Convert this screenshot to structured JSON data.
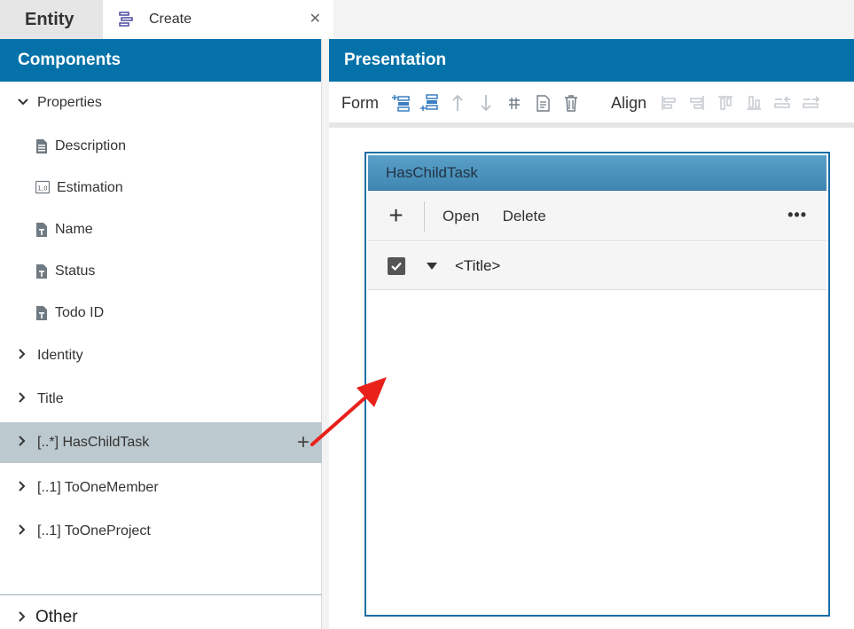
{
  "tabs": {
    "entity_label": "Entity",
    "create_label": "Create",
    "close_glyph": "✕"
  },
  "components": {
    "header": "Components",
    "properties_label": "Properties",
    "properties_children": [
      {
        "label": "Description",
        "icon": "document-icon"
      },
      {
        "label": "Estimation",
        "icon": "number-icon"
      },
      {
        "label": "Name",
        "icon": "text-field-icon"
      },
      {
        "label": "Status",
        "icon": "text-field-icon"
      },
      {
        "label": "Todo ID",
        "icon": "text-field-icon"
      }
    ],
    "items": [
      {
        "label": "Identity"
      },
      {
        "label": "Title"
      },
      {
        "label": "[..*] HasChildTask",
        "selected": true
      },
      {
        "label": "[..1] ToOneMember"
      },
      {
        "label": "[..1] ToOneProject"
      }
    ],
    "other_label": "Other",
    "add_glyph": "+"
  },
  "presentation": {
    "header": "Presentation",
    "form_label": "Form",
    "align_label": "Align"
  },
  "widget": {
    "title": "HasChildTask",
    "add_glyph": "+",
    "open_label": "Open",
    "delete_label": "Delete",
    "more_glyph": "•••",
    "column_label": "<Title>"
  },
  "colors": {
    "header_blue": "#0472a8",
    "selected_row": "#bcc9ce",
    "arrow_red": "#e8221b"
  }
}
